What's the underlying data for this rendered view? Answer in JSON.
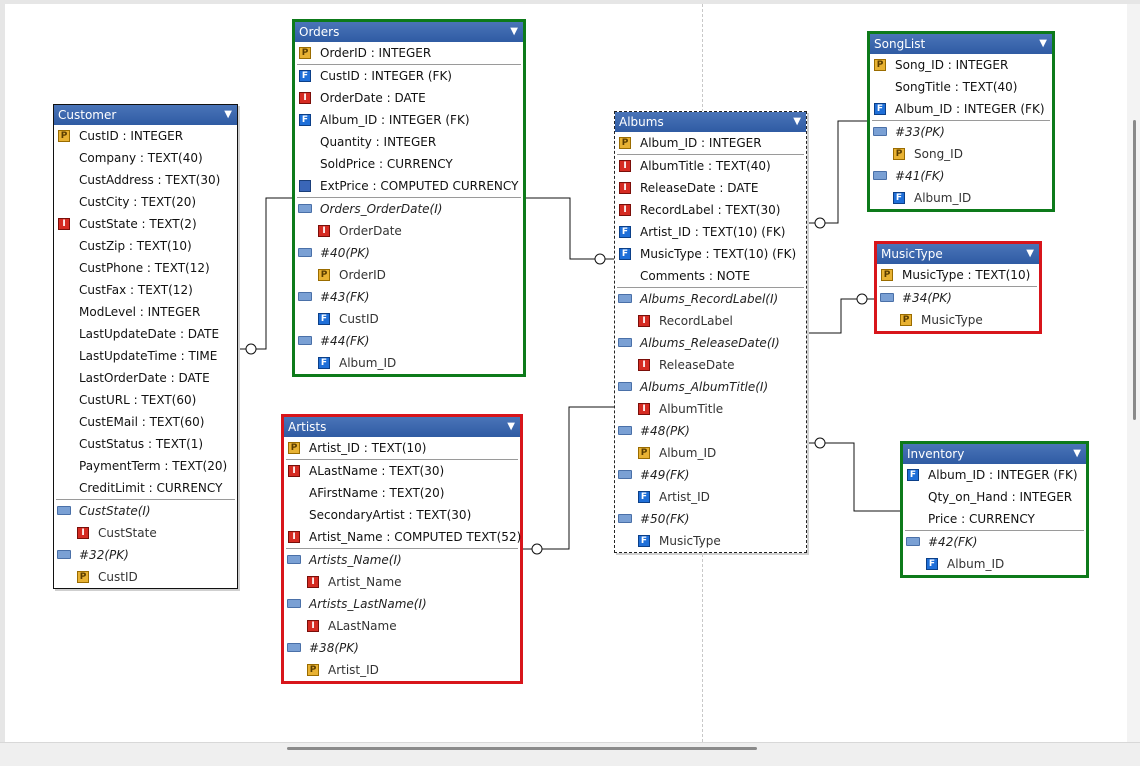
{
  "colors": {
    "header": "#3a64ad",
    "green_border": "#0d7a1a",
    "red_border": "#d8151b",
    "link": "#111111"
  },
  "tables": [
    {
      "id": "customer",
      "title": "Customer",
      "style": "plain",
      "rows": [
        {
          "t": "P",
          "text": "CustID : INTEGER"
        },
        {
          "t": "",
          "text": "Company : TEXT(40)"
        },
        {
          "t": "",
          "text": "CustAddress : TEXT(30)"
        },
        {
          "t": "",
          "text": "CustCity : TEXT(20)"
        },
        {
          "t": "I",
          "text": "CustState : TEXT(2)"
        },
        {
          "t": "",
          "text": "CustZip : TEXT(10)"
        },
        {
          "t": "",
          "text": "CustPhone : TEXT(12)"
        },
        {
          "t": "",
          "text": "CustFax : TEXT(12)"
        },
        {
          "t": "",
          "text": "ModLevel : INTEGER"
        },
        {
          "t": "",
          "text": "LastUpdateDate : DATE"
        },
        {
          "t": "",
          "text": "LastUpdateTime : TIME"
        },
        {
          "t": "",
          "text": "LastOrderDate : DATE"
        },
        {
          "t": "",
          "text": "CustURL : TEXT(60)"
        },
        {
          "t": "",
          "text": "CustEMail : TEXT(60)"
        },
        {
          "t": "",
          "text": "CustStatus : TEXT(1)"
        },
        {
          "t": "",
          "text": "PaymentTerm : TEXT(20)"
        },
        {
          "t": "",
          "text": "CreditLimit : CURRENCY"
        },
        {
          "sep": true
        },
        {
          "t": "folder",
          "text": "CustState(I)",
          "idx": true
        },
        {
          "t": "I",
          "text": "CustState",
          "sub": true
        },
        {
          "t": "folder",
          "text": "#32(PK)",
          "idx": true
        },
        {
          "t": "P",
          "text": "CustID",
          "sub": true
        }
      ]
    },
    {
      "id": "orders",
      "title": "Orders",
      "style": "green",
      "rows": [
        {
          "t": "P",
          "text": "OrderID : INTEGER"
        },
        {
          "sep": true
        },
        {
          "t": "F",
          "text": "CustID : INTEGER (FK)"
        },
        {
          "t": "I",
          "text": "OrderDate : DATE"
        },
        {
          "t": "F",
          "text": "Album_ID : INTEGER (FK)"
        },
        {
          "t": "",
          "text": "Quantity : INTEGER"
        },
        {
          "t": "",
          "text": "SoldPrice : CURRENCY"
        },
        {
          "t": "C",
          "text": "ExtPrice : COMPUTED CURRENCY"
        },
        {
          "sep": true
        },
        {
          "t": "folder",
          "text": "Orders_OrderDate(I)",
          "idx": true
        },
        {
          "t": "I",
          "text": "OrderDate",
          "sub": true
        },
        {
          "t": "folder",
          "text": "#40(PK)",
          "idx": true
        },
        {
          "t": "P",
          "text": "OrderID",
          "sub": true
        },
        {
          "t": "folder",
          "text": "#43(FK)",
          "idx": true
        },
        {
          "t": "F",
          "text": "CustID",
          "sub": true
        },
        {
          "t": "folder",
          "text": "#44(FK)",
          "idx": true
        },
        {
          "t": "F",
          "text": "Album_ID",
          "sub": true
        }
      ]
    },
    {
      "id": "artists",
      "title": "Artists",
      "style": "red",
      "rows": [
        {
          "t": "P",
          "text": "Artist_ID : TEXT(10)"
        },
        {
          "sep": true
        },
        {
          "t": "I",
          "text": "ALastName : TEXT(30)"
        },
        {
          "t": "",
          "text": "AFirstName : TEXT(20)"
        },
        {
          "t": "",
          "text": "SecondaryArtist : TEXT(30)"
        },
        {
          "t": "I",
          "text": "Artist_Name : COMPUTED TEXT(52)"
        },
        {
          "sep": true
        },
        {
          "t": "folder",
          "text": "Artists_Name(I)",
          "idx": true
        },
        {
          "t": "I",
          "text": "Artist_Name",
          "sub": true
        },
        {
          "t": "folder",
          "text": "Artists_LastName(I)",
          "idx": true
        },
        {
          "t": "I",
          "text": "ALastName",
          "sub": true
        },
        {
          "t": "folder",
          "text": "#38(PK)",
          "idx": true
        },
        {
          "t": "P",
          "text": "Artist_ID",
          "sub": true
        }
      ]
    },
    {
      "id": "albums",
      "title": "Albums",
      "style": "dotted",
      "rows": [
        {
          "t": "P",
          "text": "Album_ID : INTEGER"
        },
        {
          "sep": true
        },
        {
          "t": "I",
          "text": "AlbumTitle : TEXT(40)"
        },
        {
          "t": "I",
          "text": "ReleaseDate : DATE"
        },
        {
          "t": "I",
          "text": "RecordLabel : TEXT(30)"
        },
        {
          "t": "F",
          "text": "Artist_ID : TEXT(10) (FK)"
        },
        {
          "t": "F",
          "text": "MusicType : TEXT(10) (FK)"
        },
        {
          "t": "",
          "text": "Comments : NOTE"
        },
        {
          "sep": true
        },
        {
          "t": "folder",
          "text": "Albums_RecordLabel(I)",
          "idx": true
        },
        {
          "t": "I",
          "text": "RecordLabel",
          "sub": true
        },
        {
          "t": "folder",
          "text": "Albums_ReleaseDate(I)",
          "idx": true
        },
        {
          "t": "I",
          "text": "ReleaseDate",
          "sub": true
        },
        {
          "t": "folder",
          "text": "Albums_AlbumTitle(I)",
          "idx": true
        },
        {
          "t": "I",
          "text": "AlbumTitle",
          "sub": true
        },
        {
          "t": "folder",
          "text": "#48(PK)",
          "idx": true
        },
        {
          "t": "P",
          "text": "Album_ID",
          "sub": true
        },
        {
          "t": "folder",
          "text": "#49(FK)",
          "idx": true
        },
        {
          "t": "F",
          "text": "Artist_ID",
          "sub": true
        },
        {
          "t": "folder",
          "text": "#50(FK)",
          "idx": true
        },
        {
          "t": "F",
          "text": "MusicType",
          "sub": true
        }
      ]
    },
    {
      "id": "songlist",
      "title": "SongList",
      "style": "green",
      "rows": [
        {
          "t": "P",
          "text": "Song_ID : INTEGER"
        },
        {
          "t": "",
          "text": "SongTitle : TEXT(40)"
        },
        {
          "t": "F",
          "text": "Album_ID : INTEGER (FK)"
        },
        {
          "sep": true
        },
        {
          "t": "folder",
          "text": "#33(PK)",
          "idx": true
        },
        {
          "t": "P",
          "text": "Song_ID",
          "sub": true
        },
        {
          "t": "folder",
          "text": "#41(FK)",
          "idx": true
        },
        {
          "t": "F",
          "text": "Album_ID",
          "sub": true
        }
      ]
    },
    {
      "id": "musictype",
      "title": "MusicType",
      "style": "red",
      "rows": [
        {
          "t": "P",
          "text": "MusicType : TEXT(10)"
        },
        {
          "sep": true
        },
        {
          "t": "folder",
          "text": "#34(PK)",
          "idx": true
        },
        {
          "t": "P",
          "text": "MusicType",
          "sub": true
        }
      ]
    },
    {
      "id": "inventory",
      "title": "Inventory",
      "style": "green",
      "rows": [
        {
          "t": "F",
          "text": "Album_ID : INTEGER (FK)"
        },
        {
          "t": "",
          "text": "Qty_on_Hand : INTEGER"
        },
        {
          "t": "",
          "text": "Price : CURRENCY"
        },
        {
          "sep": true
        },
        {
          "t": "folder",
          "text": "#42(FK)",
          "idx": true
        },
        {
          "t": "F",
          "text": "Album_ID",
          "sub": true
        }
      ]
    }
  ],
  "relationships": [
    {
      "from": "customer",
      "to": "orders"
    },
    {
      "from": "orders",
      "to": "albums"
    },
    {
      "from": "artists",
      "to": "albums"
    },
    {
      "from": "albums",
      "to": "songlist"
    },
    {
      "from": "albums",
      "to": "musictype"
    },
    {
      "from": "albums",
      "to": "inventory"
    }
  ]
}
